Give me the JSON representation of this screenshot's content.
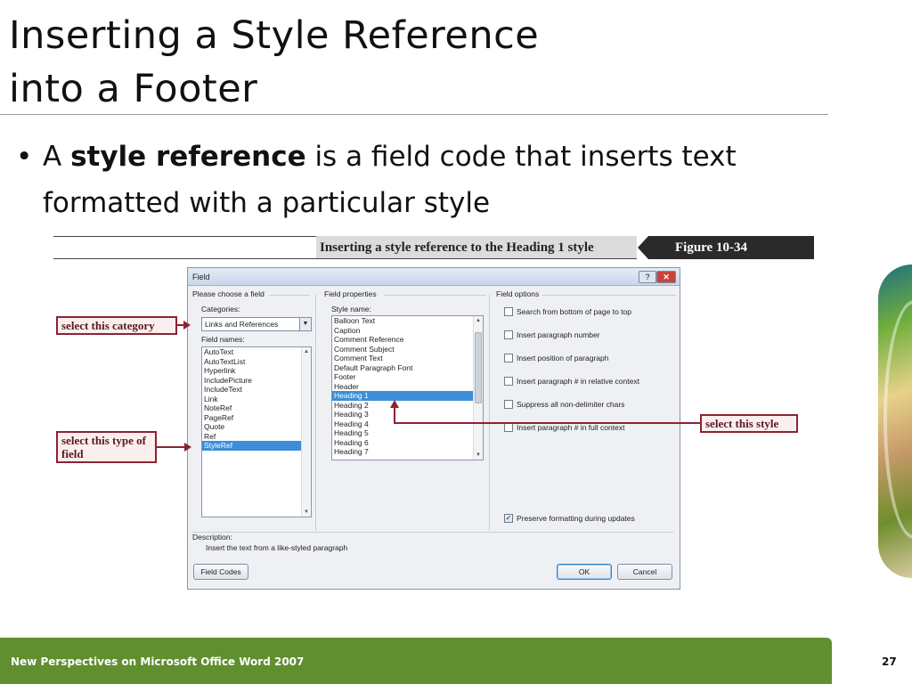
{
  "slide": {
    "title_line1": "Inserting a Style Reference",
    "title_line2": "into a Footer",
    "bullet_prefix": "A ",
    "bullet_bold": "style reference",
    "bullet_suffix": " is a field code that inserts text formatted with a particular style",
    "footer_text": "New Perspectives on Microsoft Office Word 2007",
    "page_number": "27"
  },
  "figure": {
    "caption": "Inserting a style reference to the Heading 1 style",
    "label": "Figure  10-34"
  },
  "dialog": {
    "title": "Field",
    "help_button": "?",
    "close_button": "✕",
    "choose_field_label": "Please choose a field",
    "categories_label": "Categories:",
    "categories_value": "Links and References",
    "field_names_label": "Field names:",
    "field_names": [
      "AutoText",
      "AutoTextList",
      "Hyperlink",
      "IncludePicture",
      "IncludeText",
      "Link",
      "NoteRef",
      "PageRef",
      "Quote",
      "Ref",
      "StyleRef"
    ],
    "selected_field_name": "StyleRef",
    "field_properties_label": "Field properties",
    "style_name_label": "Style name:",
    "style_names": [
      "Balloon Text",
      "Caption",
      "Comment Reference",
      "Comment Subject",
      "Comment Text",
      "Default Paragraph Font",
      "Footer",
      "Header",
      "Heading 1",
      "Heading 2",
      "Heading 3",
      "Heading 4",
      "Heading 5",
      "Heading 6",
      "Heading 7"
    ],
    "selected_style": "Heading 1",
    "field_options_label": "Field options",
    "options": [
      {
        "label": "Search from bottom of page to top",
        "checked": false
      },
      {
        "label": "Insert paragraph number",
        "checked": false
      },
      {
        "label": "Insert position of paragraph",
        "checked": false
      },
      {
        "label": "Insert paragraph # in relative context",
        "checked": false
      },
      {
        "label": "Suppress all non-delimiter chars",
        "checked": false
      },
      {
        "label": "Insert paragraph # in full context",
        "checked": false
      }
    ],
    "preserve_label": "Preserve formatting during updates",
    "preserve_checked": true,
    "description_label": "Description:",
    "description_text": "Insert the text from a like-styled paragraph",
    "field_codes_button": "Field Codes",
    "ok_button": "OK",
    "cancel_button": "Cancel"
  },
  "callouts": {
    "category": "select this category",
    "field_type": "select this type of field",
    "style": "select this style"
  }
}
